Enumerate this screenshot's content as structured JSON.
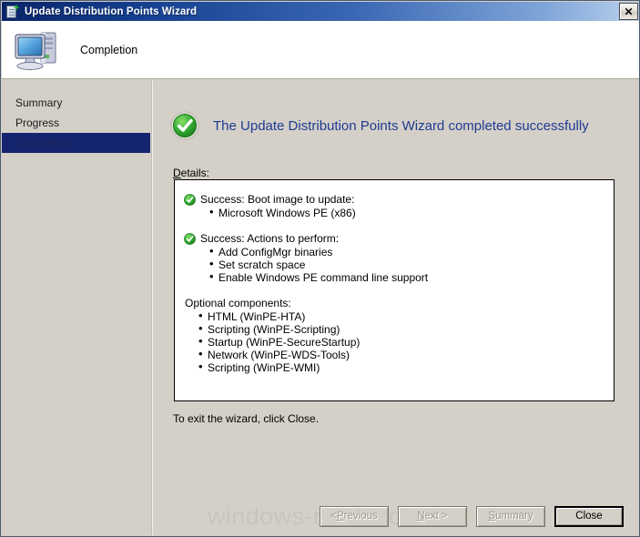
{
  "window": {
    "title": "Update Distribution Points Wizard",
    "title_icon": "wizard-page-icon",
    "close_label": "✕"
  },
  "header": {
    "icon": "computer-icon",
    "title": "Completion"
  },
  "sidebar": {
    "items": [
      {
        "label": "Summary",
        "selected": false
      },
      {
        "label": "Progress",
        "selected": false
      },
      {
        "label": "Completion",
        "selected": true
      }
    ]
  },
  "main": {
    "status_icon": "green-check-circle-icon",
    "status_text": "The Update Distribution Points Wizard completed successfully",
    "details_label_accel": "D",
    "details_label_rest": "etails:",
    "details": {
      "groups": [
        {
          "icon": "green-check-icon",
          "heading": "Success: Boot image to update:",
          "items": [
            "Microsoft Windows PE (x86)"
          ]
        },
        {
          "icon": "green-check-icon",
          "heading": "Success: Actions to perform:",
          "items": [
            "Add ConfigMgr binaries",
            "Set scratch space",
            "Enable Windows PE command line support"
          ]
        },
        {
          "icon": null,
          "heading": "Optional components:",
          "items": [
            "HTML (WinPE-HTA)",
            "Scripting (WinPE-Scripting)",
            "Startup (WinPE-SecureStartup)",
            "Network (WinPE-WDS-Tools)",
            "Scripting (WinPE-WMI)"
          ]
        }
      ]
    },
    "exit_text": "To exit the wizard, click Close."
  },
  "buttons": {
    "previous": {
      "prefix": "< ",
      "accel": "P",
      "rest": "revious",
      "enabled": false
    },
    "next": {
      "accel": "N",
      "rest": "ext >",
      "enabled": false
    },
    "summary": {
      "accel": "S",
      "rest": "ummary",
      "enabled": false
    },
    "close": {
      "label": "Close",
      "enabled": true
    }
  },
  "watermark": {
    "text": "windows-noob.com"
  },
  "colors": {
    "titlebar_start": "#0a246a",
    "titlebar_end": "#b9d0ec",
    "dialog_face": "#d4d0c8",
    "selected_nav": "#14246e",
    "success_heading": "#1f3a93",
    "check_green": "#3bb03b"
  }
}
